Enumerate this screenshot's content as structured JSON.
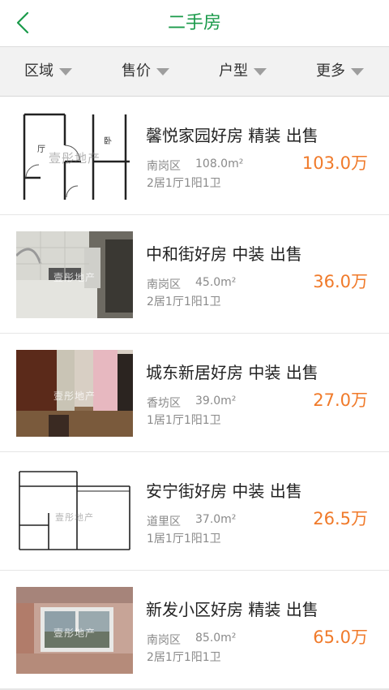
{
  "header": {
    "title": "二手房"
  },
  "filters": [
    "区域",
    "售价",
    "户型",
    "更多"
  ],
  "listings": [
    {
      "title": "馨悦家园好房 精装 出售",
      "district": "南岗区",
      "area": "108.0m²",
      "layout": "2居1厅1阳1卫",
      "price": "103.0万",
      "thumbnail": "floorplan-image",
      "watermark": "壹彤地产"
    },
    {
      "title": "中和街好房 中装 出售",
      "district": "南岗区",
      "area": "45.0m²",
      "layout": "2居1厅1阳1卫",
      "price": "36.0万",
      "thumbnail": "kitchen-photo",
      "watermark": "壹彤地产"
    },
    {
      "title": "城东新居好房 中装 出售",
      "district": "香坊区",
      "area": "39.0m²",
      "layout": "1居1厅1阳1卫",
      "price": "27.0万",
      "thumbnail": "room-photo",
      "watermark": "壹彤地产"
    },
    {
      "title": "安宁街好房 中装 出售",
      "district": "道里区",
      "area": "37.0m²",
      "layout": "1居1厅1阳1卫",
      "price": "26.5万",
      "thumbnail": "floorplan-image",
      "watermark": "壹彤地产"
    },
    {
      "title": "新发小区好房 精装 出售",
      "district": "南岗区",
      "area": "85.0m²",
      "layout": "2居1厅1阳1卫",
      "price": "65.0万",
      "thumbnail": "window-room-photo",
      "watermark": "壹彤地产"
    }
  ],
  "colors": {
    "accent": "#1a9a4a",
    "price": "#f07a2a",
    "filter_bg": "#f2f2f2"
  }
}
